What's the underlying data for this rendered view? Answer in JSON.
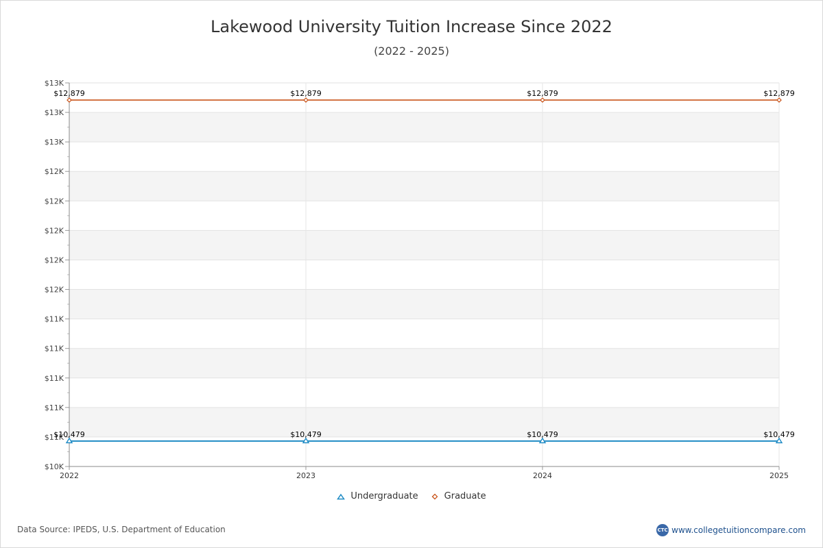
{
  "chart_data": {
    "type": "line",
    "title": "Lakewood University Tuition Increase Since 2022",
    "subtitle": "(2022 - 2025)",
    "x": [
      "2022",
      "2023",
      "2024",
      "2025"
    ],
    "series": [
      {
        "name": "Undergraduate",
        "values": [
          10479,
          10479,
          10479,
          10479
        ],
        "labels": [
          "$10,479",
          "$10,479",
          "$10,479",
          "$10,479"
        ],
        "color": "#1f8bc5",
        "marker": "triangle"
      },
      {
        "name": "Graduate",
        "values": [
          12879,
          12879,
          12879,
          12879
        ],
        "labels": [
          "$12,879",
          "$12,879",
          "$12,879",
          "$12,879"
        ],
        "color": "#c9541a",
        "marker": "diamond"
      }
    ],
    "ylim": [
      10300,
      13000
    ],
    "ytick_labels": [
      "$10K",
      "$11K",
      "$11K",
      "$11K",
      "$11K",
      "$11K",
      "$12K",
      "$12K",
      "$12K",
      "$12K",
      "$12K",
      "$13K",
      "$13K",
      "$13K"
    ],
    "grid": true,
    "legend": "bottom-center"
  },
  "footer": {
    "source": "Data Source: IPEDS, U.S. Department of Education",
    "logo_text": "CTC",
    "site": "www.collegetuitioncompare.com"
  }
}
